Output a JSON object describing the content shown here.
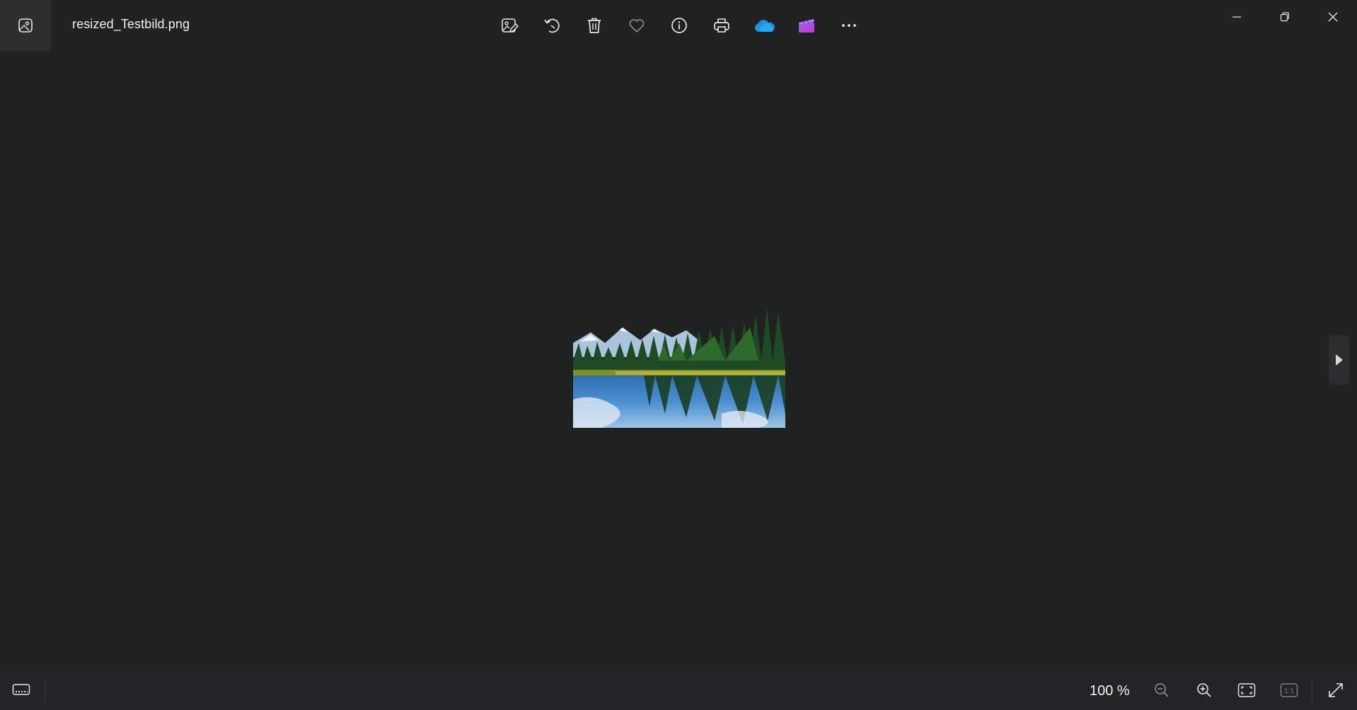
{
  "titlebar": {
    "file_name": "resized_Testbild.png",
    "toolbar_icons": [
      "edit-image-icon",
      "rotate-icon",
      "delete-icon",
      "favorite-heart-icon",
      "info-icon",
      "print-icon",
      "onedrive-cloud-icon",
      "clipchamp-icon",
      "more-options-icon"
    ],
    "window_controls": [
      "minimize-icon",
      "restore-icon",
      "close-icon"
    ]
  },
  "viewer": {
    "image_description_icon": "landscape-photo",
    "next_icon": "next-arrow-icon"
  },
  "bottombar": {
    "zoom_level": "100 %",
    "buttons": [
      "filmstrip-icon",
      "zoom-out-icon",
      "zoom-in-icon",
      "fit-to-window-icon",
      "actual-size-icon",
      "fullscreen-icon"
    ],
    "actual_size_label": "1:1"
  },
  "colors": {
    "background": "#202222",
    "onedrive": "#1e8fe1",
    "clipchamp_start": "#9b5cf6",
    "clipchamp_end": "#c13cc9"
  }
}
